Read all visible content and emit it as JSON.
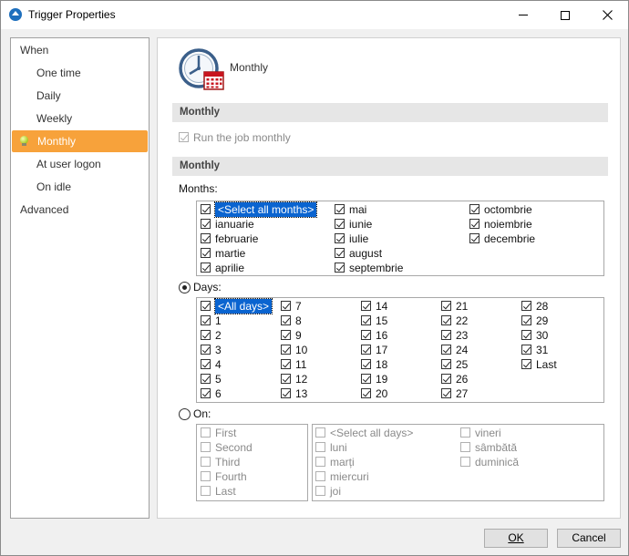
{
  "window": {
    "title": "Trigger Properties"
  },
  "sidebar": {
    "items": [
      {
        "label": "When",
        "indent": false,
        "active": false
      },
      {
        "label": "One time",
        "indent": true,
        "active": false
      },
      {
        "label": "Daily",
        "indent": true,
        "active": false
      },
      {
        "label": "Weekly",
        "indent": true,
        "active": false
      },
      {
        "label": "Monthly",
        "indent": true,
        "active": true
      },
      {
        "label": "At user logon",
        "indent": true,
        "active": false
      },
      {
        "label": "On idle",
        "indent": true,
        "active": false
      },
      {
        "label": "Advanced",
        "indent": false,
        "active": false
      }
    ]
  },
  "header": {
    "title": "Monthly",
    "icon": "clock-calendar-icon"
  },
  "section1": {
    "title": "Monthly",
    "run_monthly_label": "Run the job monthly",
    "run_monthly_checked": true
  },
  "section2": {
    "title": "Monthly",
    "months_label": "Months:",
    "months": [
      {
        "label": "<Select all months>",
        "checked": true,
        "selected": true
      },
      {
        "label": "ianuarie",
        "checked": true
      },
      {
        "label": "februarie",
        "checked": true
      },
      {
        "label": "martie",
        "checked": true
      },
      {
        "label": "aprilie",
        "checked": true
      },
      {
        "label": "mai",
        "checked": true
      },
      {
        "label": "iunie",
        "checked": true
      },
      {
        "label": "iulie",
        "checked": true
      },
      {
        "label": "august",
        "checked": true
      },
      {
        "label": "septembrie",
        "checked": true
      },
      {
        "label": "octombrie",
        "checked": true
      },
      {
        "label": "noiembrie",
        "checked": true
      },
      {
        "label": "decembrie",
        "checked": true
      }
    ],
    "days_radio_label": "Days:",
    "days_radio_selected": true,
    "days": [
      {
        "label": "<All days>",
        "checked": true,
        "selected": true
      },
      {
        "label": "1",
        "checked": true
      },
      {
        "label": "2",
        "checked": true
      },
      {
        "label": "3",
        "checked": true
      },
      {
        "label": "4",
        "checked": true
      },
      {
        "label": "5",
        "checked": true
      },
      {
        "label": "6",
        "checked": true
      },
      {
        "label": "7",
        "checked": true
      },
      {
        "label": "8",
        "checked": true
      },
      {
        "label": "9",
        "checked": true
      },
      {
        "label": "10",
        "checked": true
      },
      {
        "label": "11",
        "checked": true
      },
      {
        "label": "12",
        "checked": true
      },
      {
        "label": "13",
        "checked": true
      },
      {
        "label": "14",
        "checked": true
      },
      {
        "label": "15",
        "checked": true
      },
      {
        "label": "16",
        "checked": true
      },
      {
        "label": "17",
        "checked": true
      },
      {
        "label": "18",
        "checked": true
      },
      {
        "label": "19",
        "checked": true
      },
      {
        "label": "20",
        "checked": true
      },
      {
        "label": "21",
        "checked": true
      },
      {
        "label": "22",
        "checked": true
      },
      {
        "label": "23",
        "checked": true
      },
      {
        "label": "24",
        "checked": true
      },
      {
        "label": "25",
        "checked": true
      },
      {
        "label": "26",
        "checked": true
      },
      {
        "label": "27",
        "checked": true
      },
      {
        "label": "28",
        "checked": true
      },
      {
        "label": "29",
        "checked": true
      },
      {
        "label": "30",
        "checked": true
      },
      {
        "label": "31",
        "checked": true
      },
      {
        "label": "Last",
        "checked": true
      }
    ],
    "on_radio_label": "On:",
    "on_radio_selected": false,
    "occurrences": [
      {
        "label": "First",
        "checked": false
      },
      {
        "label": "Second",
        "checked": false
      },
      {
        "label": "Third",
        "checked": false
      },
      {
        "label": "Fourth",
        "checked": false
      },
      {
        "label": "Last",
        "checked": false
      }
    ],
    "weekdays": [
      {
        "label": "<Select all days>",
        "checked": false
      },
      {
        "label": "luni",
        "checked": false
      },
      {
        "label": "marți",
        "checked": false
      },
      {
        "label": "miercuri",
        "checked": false
      },
      {
        "label": "joi",
        "checked": false
      },
      {
        "label": "vineri",
        "checked": false
      },
      {
        "label": "sâmbătă",
        "checked": false
      },
      {
        "label": "duminică",
        "checked": false
      }
    ]
  },
  "buttons": {
    "ok_label": "OK",
    "cancel_label": "Cancel"
  },
  "colors": {
    "accent": "#f7a23b",
    "selection": "#0a64d0",
    "section_bg": "#e6e6e6"
  }
}
